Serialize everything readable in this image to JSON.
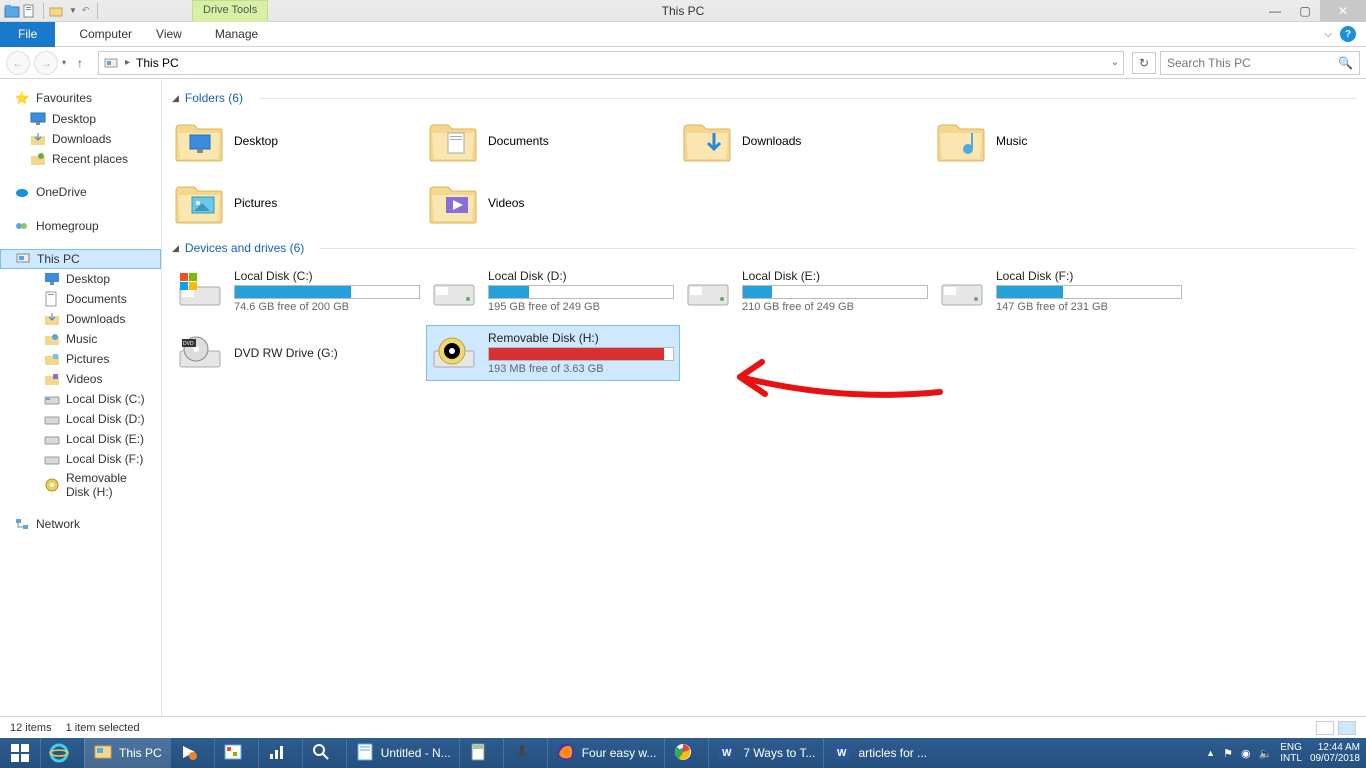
{
  "title": "This PC",
  "driveTools": "Drive Tools",
  "ribbon": {
    "file": "File",
    "computer": "Computer",
    "view": "View",
    "manage": "Manage"
  },
  "nav": {
    "location": "This PC",
    "searchPlaceholder": "Search This PC"
  },
  "sidebar": {
    "favourites": "Favourites",
    "fav_items": [
      "Desktop",
      "Downloads",
      "Recent places"
    ],
    "onedrive": "OneDrive",
    "homegroup": "Homegroup",
    "thispc": "This PC",
    "pc_items": [
      "Desktop",
      "Documents",
      "Downloads",
      "Music",
      "Pictures",
      "Videos",
      "Local Disk (C:)",
      "Local Disk (D:)",
      "Local Disk (E:)",
      "Local Disk (F:)",
      "Removable Disk (H:)"
    ],
    "network": "Network"
  },
  "sections": {
    "folders": "Folders (6)",
    "drives": "Devices and drives (6)"
  },
  "folders": [
    {
      "name": "Desktop"
    },
    {
      "name": "Documents"
    },
    {
      "name": "Downloads"
    },
    {
      "name": "Music"
    },
    {
      "name": "Pictures"
    },
    {
      "name": "Videos"
    }
  ],
  "drives": [
    {
      "name": "Local Disk (C:)",
      "free": "74.6 GB free of 200 GB",
      "fill": 63,
      "type": "os"
    },
    {
      "name": "Local Disk (D:)",
      "free": "195 GB free of 249 GB",
      "fill": 22,
      "type": "hdd"
    },
    {
      "name": "Local Disk (E:)",
      "free": "210 GB free of 249 GB",
      "fill": 16,
      "type": "hdd"
    },
    {
      "name": "Local Disk (F:)",
      "free": "147 GB free of 231 GB",
      "fill": 36,
      "type": "hdd"
    },
    {
      "name": "DVD RW Drive (G:)",
      "free": "",
      "fill": 0,
      "type": "dvd"
    },
    {
      "name": "Removable Disk (H:)",
      "free": "193 MB free of 3.63 GB",
      "fill": 95,
      "type": "usb",
      "selected": true,
      "red": true
    }
  ],
  "status": {
    "items": "12 items",
    "selected": "1 item selected"
  },
  "taskbar": {
    "apps": [
      {
        "label": "This PC",
        "icon": "explorer",
        "wide": true
      },
      {
        "label": "",
        "icon": "media"
      },
      {
        "label": "",
        "icon": "paint"
      },
      {
        "label": "",
        "icon": "chart"
      },
      {
        "label": "",
        "icon": "magnify"
      },
      {
        "label": "Untitled - N...",
        "icon": "notepad",
        "wide": true
      },
      {
        "label": "",
        "icon": "calc"
      },
      {
        "label": "",
        "icon": "mic"
      },
      {
        "label": "Four easy w...",
        "icon": "firefox",
        "wide": true
      },
      {
        "label": "",
        "icon": "chrome"
      },
      {
        "label": "7 Ways to T...",
        "icon": "word",
        "wide": true
      },
      {
        "label": "articles for ...",
        "icon": "word",
        "wide": true
      }
    ],
    "lang": "ENG",
    "kbd": "INTL",
    "time": "12:44 AM",
    "date": "09/07/2018"
  }
}
